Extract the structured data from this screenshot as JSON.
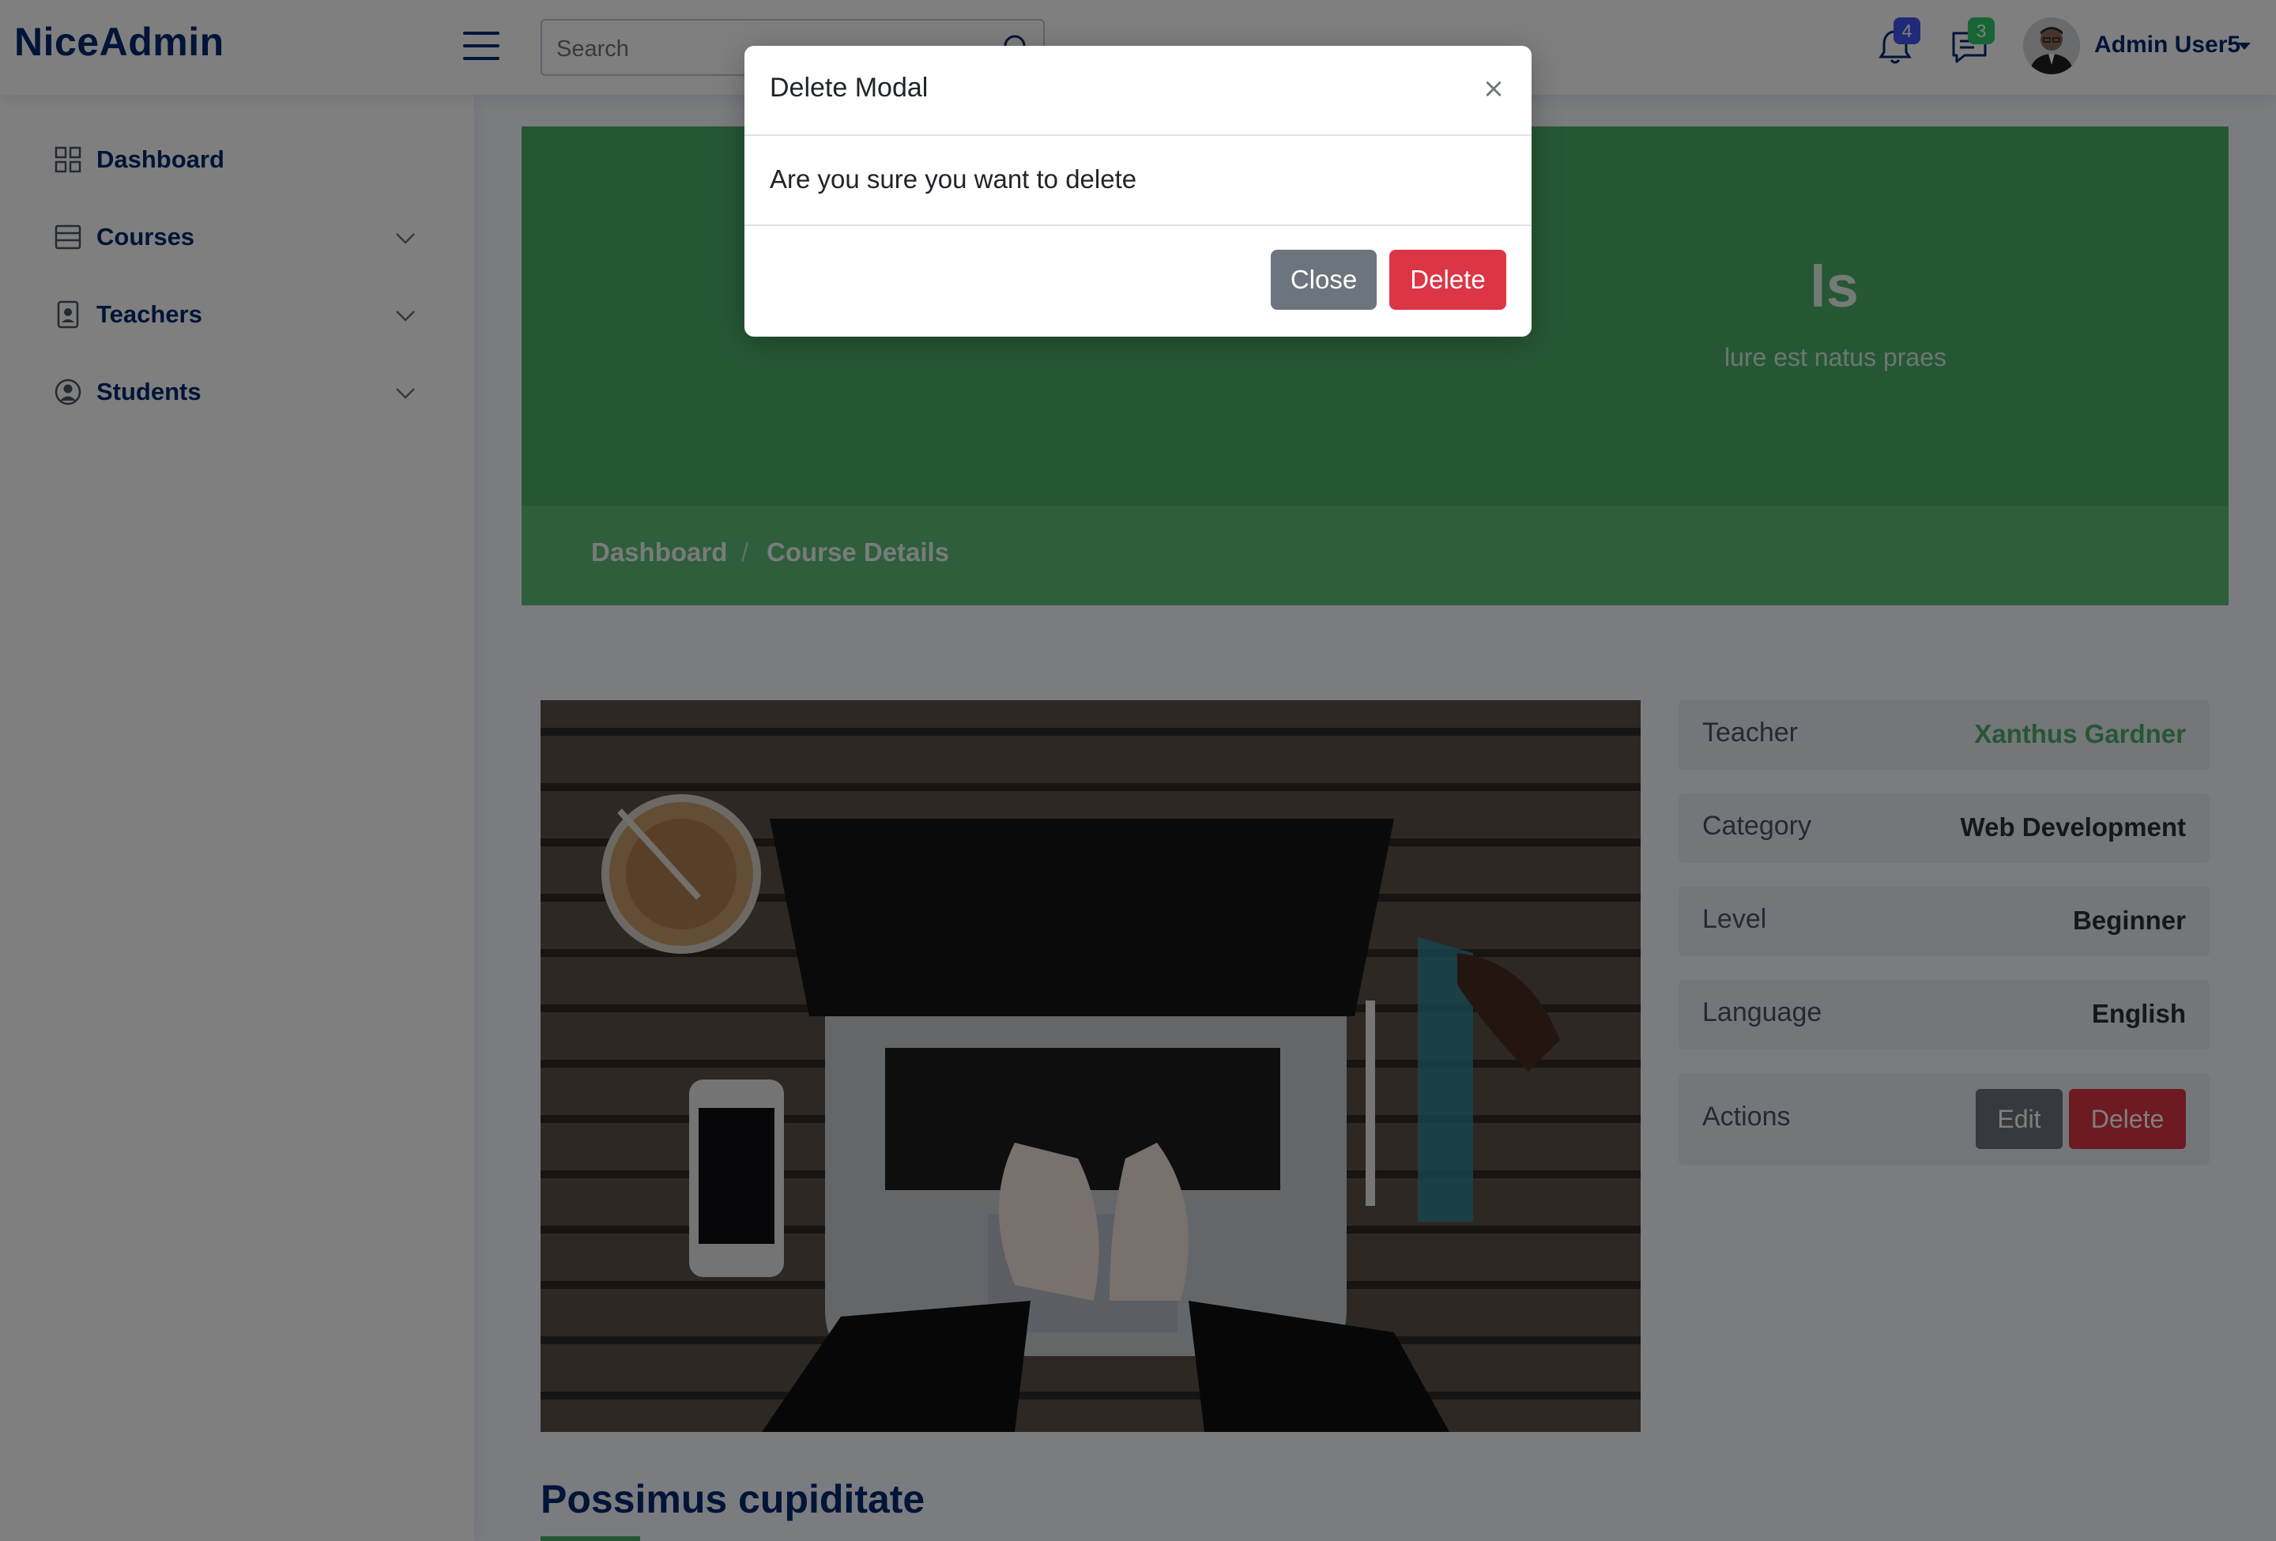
{
  "app": {
    "logo": "NiceAdmin"
  },
  "header": {
    "search_placeholder": "Search",
    "notifications_count": "4",
    "messages_count": "3",
    "profile_name": "Admin User5"
  },
  "sidebar": {
    "items": [
      {
        "label": "Dashboard",
        "icon": "grid-icon"
      },
      {
        "label": "Courses",
        "icon": "layout-icon"
      },
      {
        "label": "Teachers",
        "icon": "person-badge-icon"
      },
      {
        "label": "Students",
        "icon": "person-circle-icon"
      }
    ]
  },
  "hero": {
    "title_visible": "ls",
    "subtitle_visible": "lure est natus praes",
    "breadcrumb": [
      "Dashboard",
      "Course Details"
    ],
    "breadcrumb_separator": "/"
  },
  "details": {
    "rows": [
      {
        "key": "Teacher",
        "value": "Xanthus Gardner"
      },
      {
        "key": "Category",
        "value": "Web Development"
      },
      {
        "key": "Level",
        "value": "Beginner"
      },
      {
        "key": "Language",
        "value": "English"
      },
      {
        "key": "Actions",
        "edit": "Edit",
        "delete": "Delete"
      }
    ]
  },
  "course": {
    "heading": "Possimus cupiditate"
  },
  "modal": {
    "title": "Delete Modal",
    "close_symbol": "×",
    "body": "Are you sure you want to delete",
    "close_label": "Close",
    "delete_label": "Delete"
  },
  "colors": {
    "brand": "#012970",
    "hero_green": "#4caf6a",
    "teacher_link": "#4caf6a",
    "danger": "#dc3545",
    "secondary": "#6c757d",
    "notification_badge": "#4154f1",
    "message_badge": "#2eca6a"
  }
}
